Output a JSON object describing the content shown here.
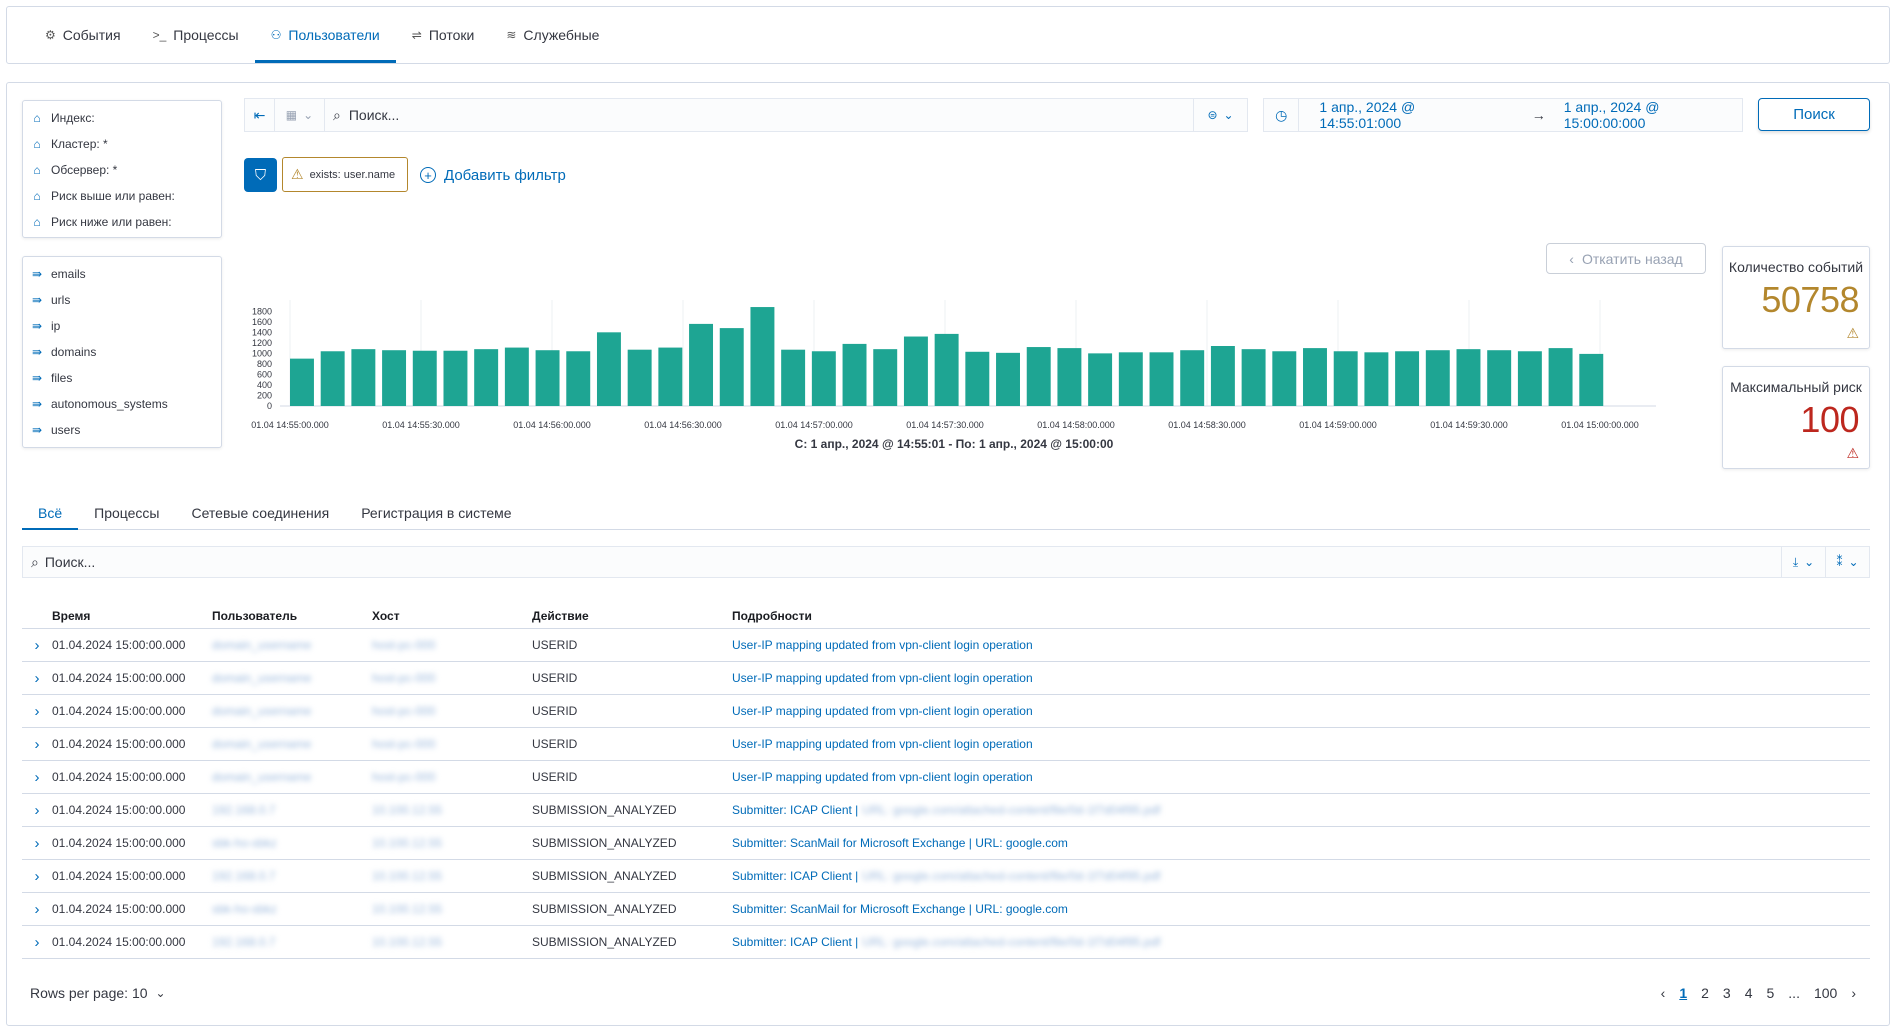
{
  "topnav": {
    "tabs": [
      {
        "label": "События",
        "icon": "events-icon",
        "glyph": "⚙"
      },
      {
        "label": "Процессы",
        "icon": "terminal-icon",
        "glyph": ">_"
      },
      {
        "label": "Пользователи",
        "icon": "users-icon",
        "glyph": "⚇"
      },
      {
        "label": "Потоки",
        "icon": "flows-icon",
        "glyph": "⇌"
      },
      {
        "label": "Служебные",
        "icon": "stack-icon",
        "glyph": "≋"
      }
    ],
    "active": 2
  },
  "sidebar": {
    "filters": [
      "Индекс:",
      "Кластер: *",
      "Обсервер: *",
      "Риск выше или равен:",
      "Риск ниже или равен:"
    ],
    "fields": [
      "emails",
      "urls",
      "ip",
      "domains",
      "files",
      "autonomous_systems",
      "users"
    ]
  },
  "query": {
    "placeholder": "Поиск...",
    "date_from": "1 апр., 2024 @ 14:55:01:000",
    "arrow": "→",
    "date_to": "1 апр., 2024 @ 15:00:00:000",
    "search_button": "Поиск",
    "filter_pill": "exists: user.name",
    "add_filter": "Добавить фильтр",
    "back_button": "Откатить назад"
  },
  "stats": {
    "events_label": "Количество событий",
    "events_value": "50758",
    "risk_label": "Максимальный риск",
    "risk_value": "100"
  },
  "colors": {
    "accent": "#006bb8",
    "bar": "#1ea593",
    "warn": "#b3872d",
    "danger": "#bd271e"
  },
  "chart_data": {
    "type": "bar",
    "y_ticks": [
      0,
      200,
      400,
      600,
      800,
      1000,
      1200,
      1400,
      1600,
      1800
    ],
    "ylim": [
      0,
      1900
    ],
    "x_ticks": [
      "01.04 14:55:00.000",
      "01.04 14:55:30.000",
      "01.04 14:56:00.000",
      "01.04 14:56:30.000",
      "01.04 14:57:00.000",
      "01.04 14:57:30.000",
      "01.04 14:58:00.000",
      "01.04 14:58:30.000",
      "01.04 14:59:00.000",
      "01.04 14:59:30.000",
      "01.04 15:00:00.000"
    ],
    "values": [
      900,
      1040,
      1080,
      1060,
      1050,
      1050,
      1080,
      1110,
      1060,
      1040,
      1400,
      1070,
      1110,
      1560,
      1480,
      1880,
      1070,
      1040,
      1180,
      1080,
      1320,
      1370,
      1030,
      1010,
      1120,
      1100,
      1000,
      1020,
      1020,
      1060,
      1140,
      1080,
      1040,
      1100,
      1040,
      1020,
      1040,
      1060,
      1080,
      1060,
      1040,
      1100,
      990
    ],
    "xlabel": "С: 1 апр., 2024 @ 14:55:01 - По: 1 апр., 2024 @ 15:00:00"
  },
  "tabs": {
    "items": [
      "Всё",
      "Процессы",
      "Сетевые соединения",
      "Регистрация в системе"
    ],
    "active": 0
  },
  "table": {
    "search_placeholder": "Поиск...",
    "columns": [
      "Время",
      "Пользователь",
      "Хост",
      "Действие",
      "Подробности"
    ],
    "rows": [
      {
        "time": "01.04.2024 15:00:00.000",
        "user": "domain_username",
        "host": "host-pc-000",
        "action": "USERID",
        "details": "User-IP mapping updated from vpn-client login operation",
        "extra": ""
      },
      {
        "time": "01.04.2024 15:00:00.000",
        "user": "domain_username",
        "host": "host-pc-000",
        "action": "USERID",
        "details": "User-IP mapping updated from vpn-client login operation",
        "extra": ""
      },
      {
        "time": "01.04.2024 15:00:00.000",
        "user": "domain_username",
        "host": "host-pc-000",
        "action": "USERID",
        "details": "User-IP mapping updated from vpn-client login operation",
        "extra": ""
      },
      {
        "time": "01.04.2024 15:00:00.000",
        "user": "domain_username",
        "host": "host-pc-000",
        "action": "USERID",
        "details": "User-IP mapping updated from vpn-client login operation",
        "extra": ""
      },
      {
        "time": "01.04.2024 15:00:00.000",
        "user": "domain_username",
        "host": "host-pc-000",
        "action": "USERID",
        "details": "User-IP mapping updated from vpn-client login operation",
        "extra": ""
      },
      {
        "time": "01.04.2024 15:00:00.000",
        "user": "192.168.0.7",
        "host": "10.100.12.55",
        "action": "SUBMISSION_ANALYZED",
        "details": "Submitter: ICAP Client |",
        "extra": "URL: google.com/attached-content/file/0d-1f7d04f95.pdf"
      },
      {
        "time": "01.04.2024 15:00:00.000",
        "user": "sbk-ho-sbkz",
        "host": "10.100.12.55",
        "action": "SUBMISSION_ANALYZED",
        "details": "Submitter: ScanMail for Microsoft Exchange | URL: google.com",
        "extra": ""
      },
      {
        "time": "01.04.2024 15:00:00.000",
        "user": "192.168.0.7",
        "host": "10.100.12.55",
        "action": "SUBMISSION_ANALYZED",
        "details": "Submitter: ICAP Client |",
        "extra": "URL: google.com/attached-content/file/0d-1f7d04f95.pdf"
      },
      {
        "time": "01.04.2024 15:00:00.000",
        "user": "sbk-ho-sbkz",
        "host": "10.100.12.55",
        "action": "SUBMISSION_ANALYZED",
        "details": "Submitter: ScanMail for Microsoft Exchange | URL: google.com",
        "extra": ""
      },
      {
        "time": "01.04.2024 15:00:00.000",
        "user": "192.168.0.7",
        "host": "10.100.12.55",
        "action": "SUBMISSION_ANALYZED",
        "details": "Submitter: ICAP Client |",
        "extra": "URL: google.com/attached-content/file/0d-1f7d04f95.pdf"
      }
    ]
  },
  "footer": {
    "rows_per_page": "Rows per page: 10",
    "pages": [
      "1",
      "2",
      "3",
      "4",
      "5",
      "...",
      "100"
    ],
    "current_page": "1"
  }
}
